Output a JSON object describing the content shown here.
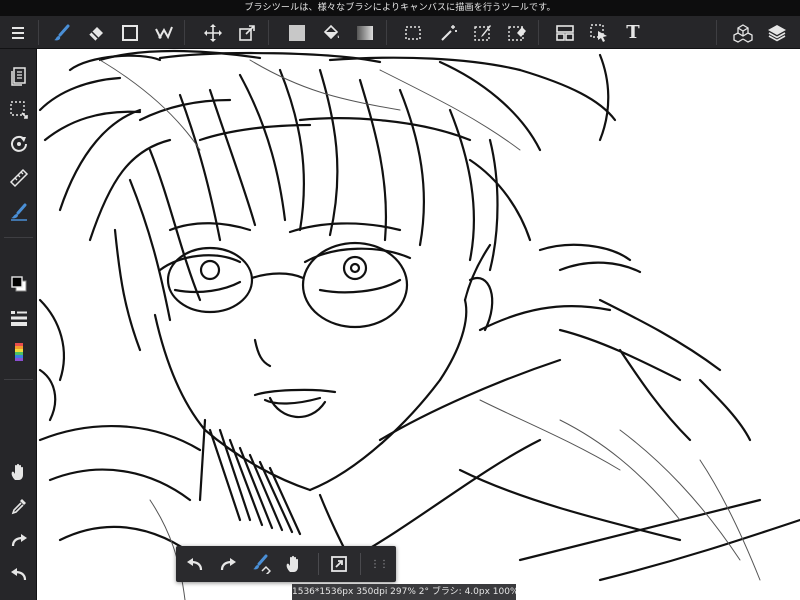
{
  "tooltip": "ブラシツールは、様々なブラシによりキャンバスに描画を行うツールです。",
  "status": "1536*1536px 350dpi 297% 2° ブラシ: 4.0px 100%",
  "toolbar": {
    "text_tool_glyph": "T",
    "tools": [
      "menu-icon",
      "brush-icon",
      "eraser-icon",
      "rect-shape-icon",
      "smudge-icon",
      "move-icon",
      "transform-icon",
      "fill-color-icon",
      "bucket-icon",
      "gradient-icon",
      "select-rect-icon",
      "magic-wand-icon",
      "select-pen-icon",
      "select-eraser-icon",
      "layout-icon",
      "select-layer-icon",
      "text-icon",
      "3d-material-icon",
      "layers-icon"
    ]
  },
  "sidebar": {
    "tools": [
      "pages-icon",
      "selection-icon",
      "rotate-icon",
      "ruler-icon",
      "snap-brush-icon",
      "color-swatch-icon",
      "brush-list-icon",
      "color-picker-icon",
      "hand-icon",
      "eyedropper-icon",
      "redo-icon",
      "undo-icon"
    ]
  },
  "quickbar": {
    "grip_glyph": "⋮⋮",
    "tools": [
      "undo-icon",
      "redo-icon",
      "brush-snap-icon",
      "hand-icon",
      "canvas-fit-icon",
      "grip-icon"
    ]
  },
  "colors": {
    "accent": "#4a8fd6",
    "foreground": "#000000",
    "background": "#ffffff",
    "chrome": "#262629"
  }
}
